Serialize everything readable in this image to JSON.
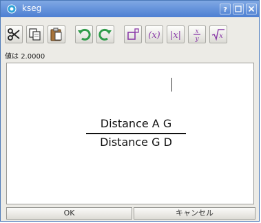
{
  "window": {
    "title": "kseg"
  },
  "value_label": {
    "prefix": "値は",
    "value": "2.0000"
  },
  "formula": {
    "numerator": "Distance A G",
    "denominator": "Distance G D"
  },
  "buttons": {
    "ok": "OK",
    "cancel": "キャンセル"
  },
  "icons": [
    "help-icon",
    "maximize-icon",
    "close-icon",
    "cut-icon",
    "copy-icon",
    "paste-icon",
    "undo-icon",
    "redo-icon",
    "superscript-icon",
    "parentheses-icon",
    "absolute-value-icon",
    "fraction-icon",
    "square-root-icon"
  ],
  "colors": {
    "titlebar": "#4d7fd2",
    "accent_purple": "#8a3aa8",
    "undo_green": "#2f9c4a"
  }
}
